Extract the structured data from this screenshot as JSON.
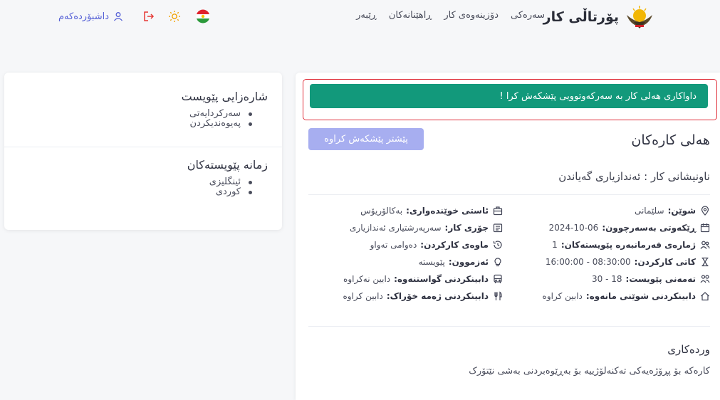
{
  "nav": {
    "brand_title": "پۆرتاڵی کار",
    "links": [
      "سەرەکی",
      "دۆزینەوەی کار",
      "ڕاهێنانەکان",
      "ڕێبەر"
    ],
    "dashboard_label": "داشبۆردەکەم"
  },
  "sidebar": {
    "skills_heading": "شارەزایی پێویست",
    "skills": [
      "سەرکردایەتی",
      "پەیوەندیکردن"
    ],
    "languages_heading": "زمانە پێویستەکان",
    "languages": [
      "ئینگلیزی",
      "کوردی"
    ]
  },
  "main": {
    "alert_text": "داواکاری هەلی کار بە سەرکەوتوویی پێشکەش کرا !",
    "title": "هەلی کارەکان",
    "applied_button": "پێشتر پێشکەش کراوە",
    "job_address": "ناونیشانی کار : ئەندازیاری گەیاندن",
    "details_right": [
      {
        "icon": "location-icon",
        "label": "شوێن:",
        "value": "سلێمانی"
      },
      {
        "icon": "calendar-icon",
        "label": "ڕێکەوتی بەسەرچوون:",
        "value": "2024-10-06"
      },
      {
        "icon": "users-icon",
        "label": "ژمارەی فەرمانبەرە پێویستەکان:",
        "value": "1"
      },
      {
        "icon": "hourglass-icon",
        "label": "کاتی کارکردن:",
        "value": "08:30:00 - 16:00:00"
      },
      {
        "icon": "age-icon",
        "label": "تەمەنی پێویست:",
        "value": "18 - 30"
      },
      {
        "icon": "home-icon",
        "label": "دابینکردنی شوێنی مانەوە:",
        "value": "دابین کراوە"
      }
    ],
    "details_left": [
      {
        "icon": "education-icon",
        "label": "ئاستی خوێندەواری:",
        "value": "بەکالۆریۆس"
      },
      {
        "icon": "briefcase-icon",
        "label": "جۆری کار:",
        "value": "سەرپەرشتیاری ئەندازیاری"
      },
      {
        "icon": "clock-rotate-icon",
        "label": "ماوەی کارکردن:",
        "value": "دەوامی تەواو"
      },
      {
        "icon": "lightbulb-icon",
        "label": "ئەزموون:",
        "value": "پێویستە"
      },
      {
        "icon": "bus-icon",
        "label": "دابینکردنی گواستنەوە:",
        "value": "دابین نەکراوە"
      },
      {
        "icon": "utensils-icon",
        "label": "دابینکردنی ژەمە خۆراک:",
        "value": "دابین کراوە"
      }
    ],
    "description_heading": "وردەکاری",
    "description_text": "کارەکە بۆ پڕۆژەیەکی تەکنەلۆژییە بۆ بەڕێوەبردنی بەشی نێتۆرک"
  },
  "colors": {
    "accent": "#5560d6",
    "success": "#12997b",
    "alert_border": "#e0303b",
    "button_disabled": "#a7aef0",
    "logout_red": "#e53935",
    "sun_orange": "#f2a100"
  }
}
